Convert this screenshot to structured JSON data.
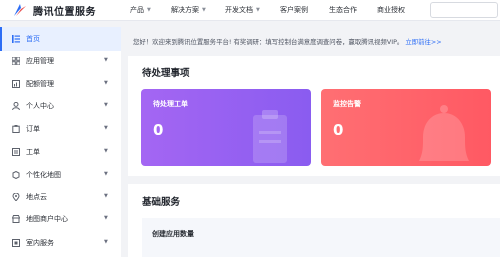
{
  "brand": {
    "name": "腾讯位置服务"
  },
  "nav": {
    "items": [
      {
        "label": "产品",
        "caret": true
      },
      {
        "label": "解决方案",
        "caret": true
      },
      {
        "label": "开发文档",
        "caret": true
      },
      {
        "label": "客户案例",
        "caret": false
      },
      {
        "label": "生态合作",
        "caret": false
      },
      {
        "label": "商业授权",
        "caret": false
      }
    ],
    "search_placeholder": ""
  },
  "sidebar": {
    "items": [
      {
        "label": "首页",
        "icon": "home-icon",
        "active": true
      },
      {
        "label": "应用管理",
        "icon": "app-grid-icon",
        "caret": true
      },
      {
        "label": "配额管理",
        "icon": "quota-icon",
        "caret": true
      },
      {
        "label": "个人中心",
        "icon": "user-icon",
        "caret": true
      },
      {
        "label": "订单",
        "icon": "order-icon",
        "caret": true
      },
      {
        "label": "工单",
        "icon": "ticket-icon",
        "caret": true
      },
      {
        "label": "个性化地图",
        "icon": "map-style-icon",
        "caret": true
      },
      {
        "label": "地点云",
        "icon": "location-cloud-icon",
        "caret": true
      },
      {
        "label": "地图商户中心",
        "icon": "merchant-icon",
        "caret": true
      },
      {
        "label": "室内服务",
        "icon": "indoor-icon",
        "caret": true
      }
    ]
  },
  "notice": {
    "text": "您好！欢迎来到腾讯位置服务平台! 有奖调研：填写控制台满意度调查问卷，赢取腾讯视频VIP。",
    "link": "立即前往>>"
  },
  "todo": {
    "title": "待处理事项",
    "cards": [
      {
        "title": "待处理工单",
        "value": "0",
        "color": "#9a62f2"
      },
      {
        "title": "监控告警",
        "value": "0",
        "color": "#ff6468"
      }
    ]
  },
  "basic": {
    "title": "基础服务",
    "sub_title": "创建应用数量"
  },
  "colors": {
    "accent": "#2c6df5"
  }
}
